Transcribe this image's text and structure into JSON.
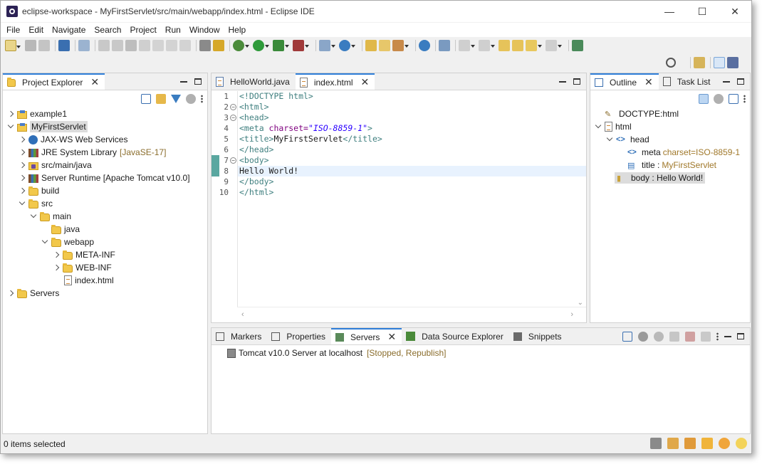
{
  "window": {
    "title": "eclipse-workspace - MyFirstServlet/src/main/webapp/index.html - Eclipse IDE",
    "controls": {
      "minimize": "—",
      "maximize": "☐",
      "close": "✕"
    }
  },
  "menu": [
    "File",
    "Edit",
    "Navigate",
    "Search",
    "Project",
    "Run",
    "Window",
    "Help"
  ],
  "project_explorer": {
    "tab_label": "Project Explorer",
    "tree": {
      "example1": "example1",
      "my_first_servlet": "MyFirstServlet",
      "jaxws": "JAX-WS Web Services",
      "jre": "JRE System Library",
      "jre_decor": "[JavaSE-17]",
      "src_main_java": "src/main/java",
      "server_runtime": "Server Runtime [Apache Tomcat v10.0]",
      "build": "build",
      "src": "src",
      "main": "main",
      "java": "java",
      "webapp": "webapp",
      "meta_inf": "META-INF",
      "web_inf": "WEB-INF",
      "index_html": "index.html",
      "servers": "Servers"
    }
  },
  "editor": {
    "tabs": [
      "HelloWorld.java",
      "index.html"
    ],
    "line_numbers": [
      "1",
      "2",
      "3",
      "4",
      "5",
      "6",
      "7",
      "8",
      "9",
      "10"
    ],
    "code": {
      "l1": "<!DOCTYPE html>",
      "l2": "<html>",
      "l3": "<head>",
      "l4_open": "<meta ",
      "l4_attr": "charset=",
      "l4_val": "\"ISO-8859-1\"",
      "l4_close": ">",
      "l5_open": "<title>",
      "l5_text": "MyFirstServlet",
      "l5_close": "</title>",
      "l6": "</head>",
      "l7": "<body>",
      "l8": "Hello World!",
      "l9": "</body>",
      "l10": "</html>"
    }
  },
  "outline": {
    "tabs": [
      "Outline",
      "Task List"
    ],
    "nodes": {
      "doctype": "DOCTYPE:html",
      "html": "html",
      "head": "head",
      "meta": "meta",
      "meta_val": "charset=ISO-8859-1",
      "title": "title :",
      "title_val": "MyFirstServlet",
      "body": "body : Hello World!"
    }
  },
  "bottom": {
    "tabs": [
      "Markers",
      "Properties",
      "Servers",
      "Data Source Explorer",
      "Snippets"
    ],
    "server_name": "Tomcat v10.0 Server at localhost",
    "server_status": "[Stopped, Republish]"
  },
  "status": {
    "text": "0 items selected"
  },
  "colors": {
    "accent": "#2f7ed8",
    "tag": "#3f7f7f",
    "attr": "#7f007f",
    "string": "#2a00ff",
    "decorator": "#8a6d2c"
  }
}
